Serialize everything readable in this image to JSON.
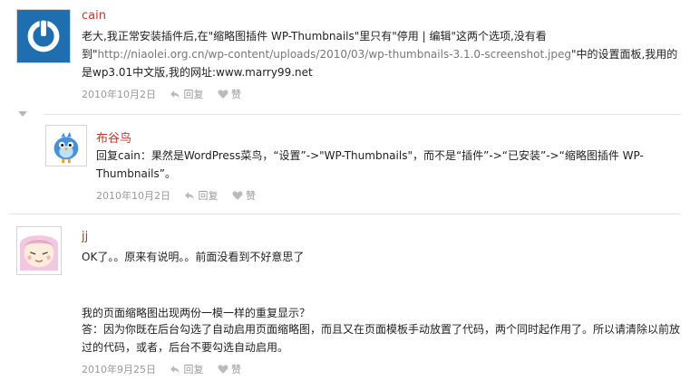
{
  "comments": [
    {
      "author": "cain",
      "text_before": "老大,我正常安装插件后,在\"缩略图插件 WP-Thumbnails\"里只有\"停用 | 编辑\"这两个选项,没有看到\"",
      "link": "http://niaolei.org.cn/wp-content/uploads/2010/03/wp-thumbnails-3.1.0-screenshot.jpeg",
      "text_after": "\"中的设置面板,我用的是wp3.01中文版,我的网址:www.marry99.net",
      "date": "2010年10月2日",
      "reply_label": "回复",
      "like_label": "赞"
    },
    {
      "author": "布谷鸟",
      "text": "回复cain：果然是WordPress菜鸟，“设置”->\"WP-Thumbnails\"，而不是“插件”->“已安装”->“缩略图插件 WP-Thumbnails”。",
      "date": "2010年10月2日",
      "reply_label": "回复",
      "like_label": "赞"
    },
    {
      "author": "jj",
      "line1": "OK了。。原来有说明。。前面没看到不好意思了",
      "line2": "我的页面缩略图出现两份一模一样的重复显示？",
      "line3": "答：因为你既在后台勾选了自动启用页面缩略图，而且又在页面模板手动放置了代码，两个同时起作用了。所以请清除以前放过的代码，或者，后台不要勾选自动启用。",
      "date": "2010年9月25日",
      "reply_label": "回复",
      "like_label": "赞"
    }
  ],
  "colors": {
    "author": "#c0392b",
    "meta": "#999999",
    "link": "#777777",
    "avatar_blue": "#1f6fb0"
  }
}
